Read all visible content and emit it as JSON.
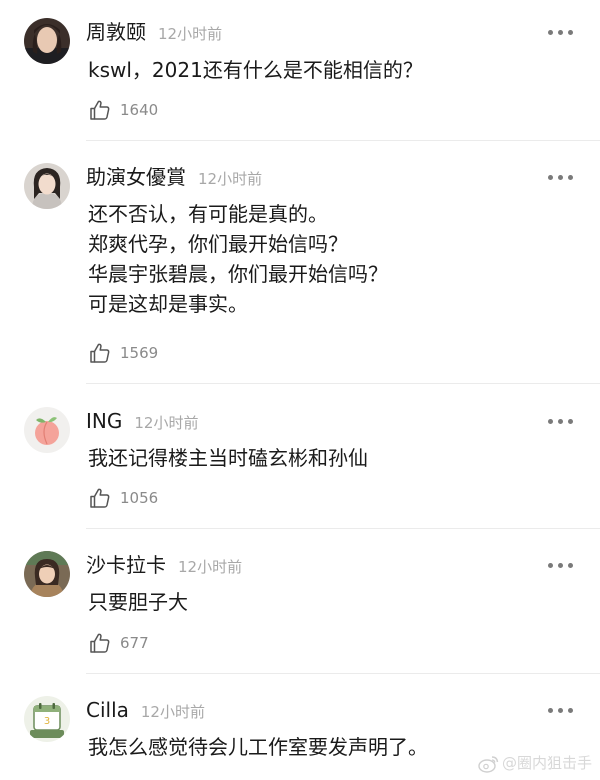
{
  "comments": [
    {
      "username": "周敦颐",
      "time": "12小时前",
      "lines": [
        "kswl，2021还有什么是不能相信的？"
      ],
      "likes": "1640",
      "avatar_icon": "user-avatar-man"
    },
    {
      "username": "助演女優賞",
      "time": "12小时前",
      "lines": [
        "还不否认，有可能是真的。",
        "郑爽代孕，你们最开始信吗？",
        "华晨宇张碧晨，你们最开始信吗？",
        "可是这却是事实。"
      ],
      "likes": "1569",
      "avatar_icon": "user-avatar-woman"
    },
    {
      "username": "ING",
      "time": "12小时前",
      "lines": [
        "我还记得楼主当时磕玄彬和孙仙"
      ],
      "likes": "1056",
      "avatar_icon": "peach-avatar"
    },
    {
      "username": "沙卡拉卡",
      "time": "12小时前",
      "lines": [
        "只要胆子大"
      ],
      "likes": "677",
      "avatar_icon": "user-avatar-girl"
    },
    {
      "username": "Cilla",
      "time": "12小时前",
      "lines": [
        "我怎么感觉待会儿工作室要发声明了。"
      ],
      "likes": "",
      "avatar_icon": "calendar-avatar"
    }
  ],
  "watermark": {
    "text": "@圈内狙击手",
    "icon": "weibo-icon"
  },
  "colors": {
    "text": "#1a1a1a",
    "muted": "#a8a8a8",
    "like_count": "#8a8a8a",
    "divider": "#ebebeb"
  }
}
